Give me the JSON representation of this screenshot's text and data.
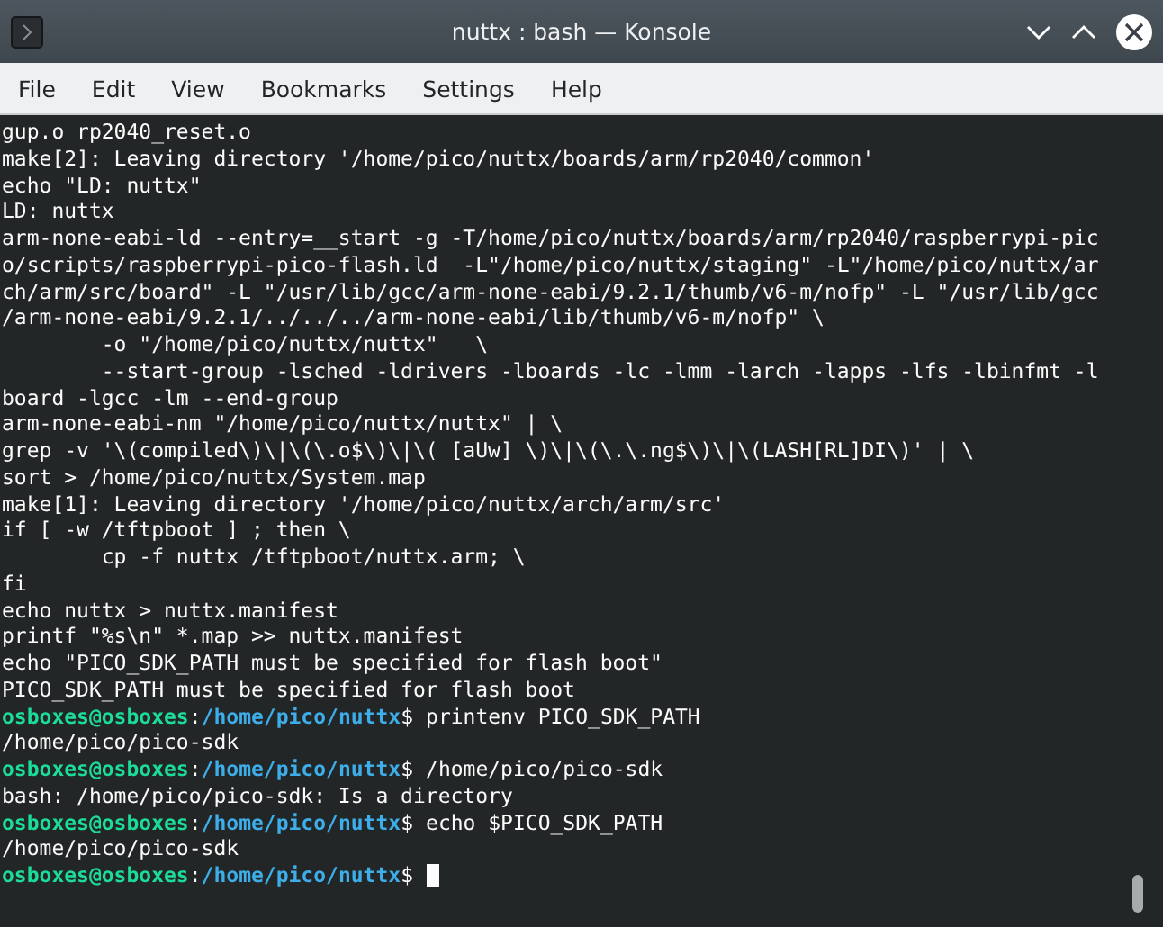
{
  "window": {
    "title": "nuttx : bash — Konsole"
  },
  "menu": [
    "File",
    "Edit",
    "View",
    "Bookmarks",
    "Settings",
    "Help"
  ],
  "terminal": {
    "cursor": true,
    "lines": [
      {
        "kind": "output",
        "text": "gup.o rp2040_reset.o"
      },
      {
        "kind": "output",
        "text": "make[2]: Leaving directory '/home/pico/nuttx/boards/arm/rp2040/common'"
      },
      {
        "kind": "output",
        "text": "echo \"LD: nuttx\""
      },
      {
        "kind": "output",
        "text": "LD: nuttx"
      },
      {
        "kind": "output",
        "text": "arm-none-eabi-ld --entry=__start -g -T/home/pico/nuttx/boards/arm/rp2040/raspberrypi-pic"
      },
      {
        "kind": "output",
        "text": "o/scripts/raspberrypi-pico-flash.ld  -L\"/home/pico/nuttx/staging\" -L\"/home/pico/nuttx/ar"
      },
      {
        "kind": "output",
        "text": "ch/arm/src/board\" -L \"/usr/lib/gcc/arm-none-eabi/9.2.1/thumb/v6-m/nofp\" -L \"/usr/lib/gcc"
      },
      {
        "kind": "output",
        "text": "/arm-none-eabi/9.2.1/../../../arm-none-eabi/lib/thumb/v6-m/nofp\" \\"
      },
      {
        "kind": "output",
        "text": "        -o \"/home/pico/nuttx/nuttx\"   \\"
      },
      {
        "kind": "output",
        "text": "        --start-group -lsched -ldrivers -lboards -lc -lmm -larch -lapps -lfs -lbinfmt -l"
      },
      {
        "kind": "output",
        "text": "board -lgcc -lm --end-group"
      },
      {
        "kind": "output",
        "text": "arm-none-eabi-nm \"/home/pico/nuttx/nuttx\" | \\"
      },
      {
        "kind": "output",
        "text": "grep -v '\\(compiled\\)\\|\\(\\.o$\\)\\|\\( [aUw] \\)\\|\\(\\.\\.ng$\\)\\|\\(LASH[RL]DI\\)' | \\"
      },
      {
        "kind": "output",
        "text": "sort > /home/pico/nuttx/System.map"
      },
      {
        "kind": "output",
        "text": "make[1]: Leaving directory '/home/pico/nuttx/arch/arm/src'"
      },
      {
        "kind": "output",
        "text": "if [ -w /tftpboot ] ; then \\"
      },
      {
        "kind": "output",
        "text": "        cp -f nuttx /tftpboot/nuttx.arm; \\"
      },
      {
        "kind": "output",
        "text": "fi"
      },
      {
        "kind": "output",
        "text": "echo nuttx > nuttx.manifest"
      },
      {
        "kind": "output",
        "text": "printf \"%s\\n\" *.map >> nuttx.manifest"
      },
      {
        "kind": "output",
        "text": "echo \"PICO_SDK_PATH must be specified for flash boot\""
      },
      {
        "kind": "output",
        "text": "PICO_SDK_PATH must be specified for flash boot"
      },
      {
        "kind": "prompt",
        "user": "osboxes@osboxes",
        "sep": ":",
        "path": "/home/pico/nuttx",
        "symbol": "$",
        "command": "printenv PICO_SDK_PATH"
      },
      {
        "kind": "output",
        "text": "/home/pico/pico-sdk"
      },
      {
        "kind": "prompt",
        "user": "osboxes@osboxes",
        "sep": ":",
        "path": "/home/pico/nuttx",
        "symbol": "$",
        "command": "/home/pico/pico-sdk"
      },
      {
        "kind": "output",
        "text": "bash: /home/pico/pico-sdk: Is a directory"
      },
      {
        "kind": "prompt",
        "user": "osboxes@osboxes",
        "sep": ":",
        "path": "/home/pico/nuttx",
        "symbol": "$",
        "command": "echo $PICO_SDK_PATH"
      },
      {
        "kind": "output",
        "text": "/home/pico/pico-sdk"
      },
      {
        "kind": "prompt",
        "user": "osboxes@osboxes",
        "sep": ":",
        "path": "/home/pico/nuttx",
        "symbol": "$"
      }
    ]
  }
}
